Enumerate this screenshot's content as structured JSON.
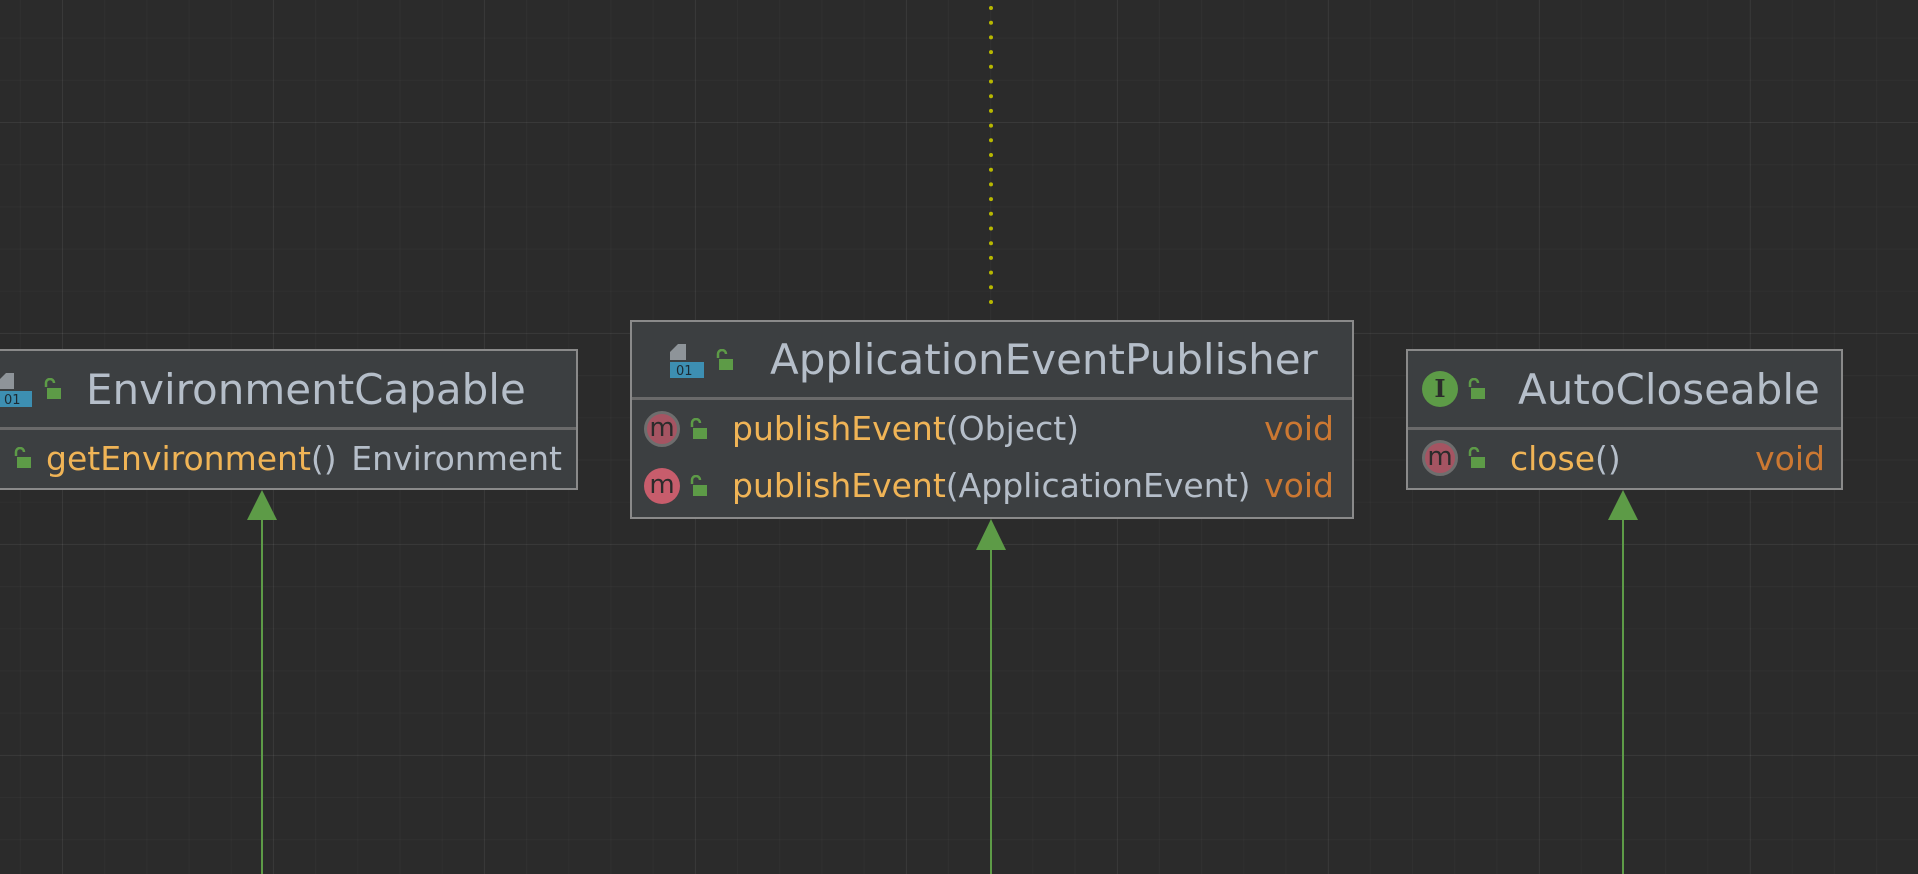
{
  "diagram": {
    "nodes": [
      {
        "name": "EnvironmentCapable",
        "kind": "interface",
        "methods": [
          {
            "name": "getEnvironment",
            "params": "()",
            "returns": "Environment",
            "abstract": false
          }
        ]
      },
      {
        "name": "ApplicationEventPublisher",
        "kind": "interface",
        "methods": [
          {
            "name": "publishEvent",
            "params": "(Object)",
            "returns": "void",
            "abstract": true
          },
          {
            "name": "publishEvent",
            "params": "(ApplicationEvent)",
            "returns": "void",
            "abstract": false
          }
        ]
      },
      {
        "name": "AutoCloseable",
        "kind": "interface",
        "methods": [
          {
            "name": "close",
            "params": "()",
            "returns": "void",
            "abstract": true
          }
        ]
      }
    ],
    "edges": [
      {
        "type": "inheritance",
        "target": "EnvironmentCapable"
      },
      {
        "type": "inheritance",
        "target": "ApplicationEventPublisher"
      },
      {
        "type": "inheritance",
        "target": "AutoCloseable"
      },
      {
        "type": "dotted",
        "source": "ApplicationEventPublisher"
      }
    ],
    "colors": {
      "background": "#2b2b2b",
      "node_fill": "#3c3f41",
      "node_border": "#8a8a8a",
      "method_name": "#f0b456",
      "return_keyword": "#cc7832",
      "text": "#b5bec9",
      "inheritance_edge": "#5d9b47",
      "dotted_edge": "#b8b800"
    },
    "icons": {
      "interface_icon": "interface-file-icon",
      "method_icon": "method-icon",
      "visibility_icon": "public-lock-icon"
    }
  }
}
